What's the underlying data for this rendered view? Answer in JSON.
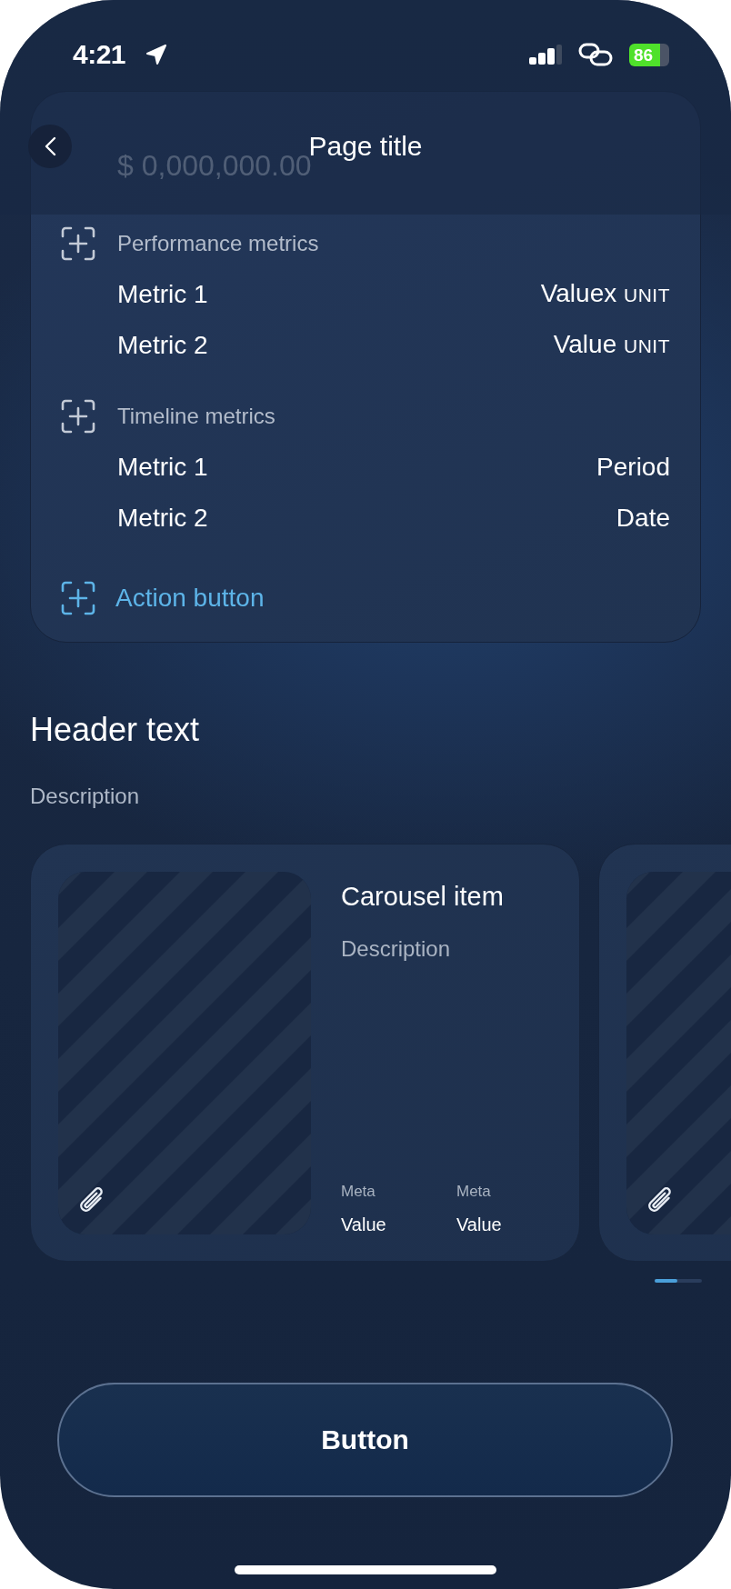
{
  "status_bar": {
    "time": "4:21",
    "battery": "86"
  },
  "nav": {
    "title": "Page title"
  },
  "summary_card": {
    "amount": "$ 0,000,000.00",
    "sections": [
      {
        "title": "Performance metrics",
        "rows": [
          {
            "label": "Metric 1",
            "value": "Valuex",
            "unit": "UNIT"
          },
          {
            "label": "Metric 2",
            "value": "Value",
            "unit": "UNIT"
          }
        ]
      },
      {
        "title": "Timeline metrics",
        "rows": [
          {
            "label": "Metric 1",
            "value": "Period"
          },
          {
            "label": "Metric 2",
            "value": "Date"
          }
        ]
      }
    ],
    "action_button": "Action button"
  },
  "section": {
    "header": "Header text",
    "description": "Description"
  },
  "carousel": {
    "items": [
      {
        "kind": "card",
        "title": "Carousel item",
        "description": "Description",
        "meta": [
          {
            "label": "Meta",
            "value": "Value"
          },
          {
            "label": "Meta",
            "value": "Value"
          }
        ]
      },
      {
        "kind": "peek"
      }
    ]
  },
  "primary_button": {
    "label": "Button"
  }
}
